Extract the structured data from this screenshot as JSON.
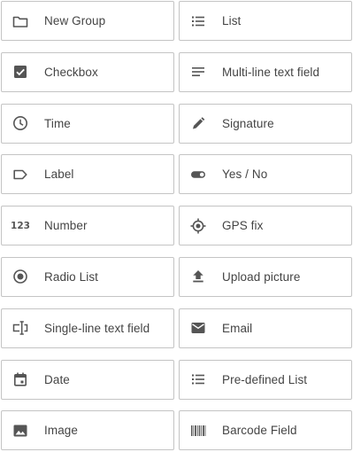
{
  "palette": {
    "border": "#c4c4c4",
    "icon": "#555555",
    "text": "#444444",
    "background": "#ffffff"
  },
  "field_types": [
    {
      "label": "New Group",
      "icon": "folder-icon"
    },
    {
      "label": "List",
      "icon": "list-icon"
    },
    {
      "label": "Checkbox",
      "icon": "checkbox-icon"
    },
    {
      "label": "Multi-line text field",
      "icon": "multiline-text-icon"
    },
    {
      "label": "Time",
      "icon": "clock-icon"
    },
    {
      "label": "Signature",
      "icon": "pen-icon"
    },
    {
      "label": "Label",
      "icon": "tag-icon"
    },
    {
      "label": "Yes / No",
      "icon": "toggle-icon"
    },
    {
      "label": "Number",
      "icon": "number-123-icon",
      "glyph": "123"
    },
    {
      "label": "GPS fix",
      "icon": "gps-crosshair-icon"
    },
    {
      "label": "Radio List",
      "icon": "radio-button-icon"
    },
    {
      "label": "Upload picture",
      "icon": "upload-icon"
    },
    {
      "label": "Single-line text field",
      "icon": "text-cursor-icon"
    },
    {
      "label": "Email",
      "icon": "envelope-icon"
    },
    {
      "label": "Date",
      "icon": "calendar-icon"
    },
    {
      "label": "Pre-defined List",
      "icon": "list-icon"
    },
    {
      "label": "Image",
      "icon": "image-icon"
    },
    {
      "label": "Barcode Field",
      "icon": "barcode-icon"
    }
  ]
}
